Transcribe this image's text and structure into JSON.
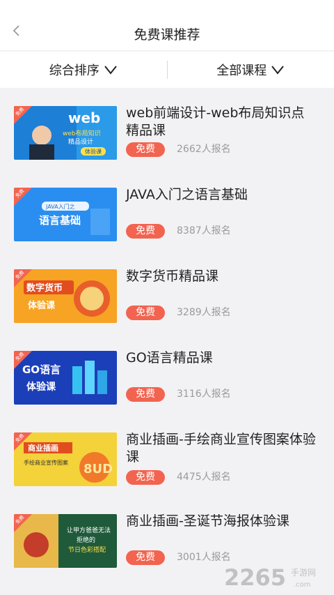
{
  "header": {
    "title": "免费课推荐",
    "back_icon": "chevron-left-icon"
  },
  "filters": [
    {
      "label": "综合排序",
      "icon": "chevron-down-icon"
    },
    {
      "label": "全部课程",
      "icon": "chevron-down-icon"
    }
  ],
  "courses": [
    {
      "title": "web前端设计-web布局知识点精品课",
      "badge": "免费",
      "enrolled": "2662人报名",
      "thumb": {
        "ribbon": "免费",
        "big": "web",
        "line1": "web布局知识",
        "line2": "精品设计",
        "tag": "体验课"
      }
    },
    {
      "title": "JAVA入门之语言基础",
      "badge": "免费",
      "enrolled": "8387人报名",
      "thumb": {
        "ribbon": "免费",
        "line1": "JAVA入门之",
        "line2": "语言基础"
      }
    },
    {
      "title": "数字货币精品课",
      "badge": "免费",
      "enrolled": "3289人报名",
      "thumb": {
        "ribbon": "免费",
        "line1": "数字货币",
        "line2": "体验课"
      }
    },
    {
      "title": "GO语言精品课",
      "badge": "免费",
      "enrolled": "3116人报名",
      "thumb": {
        "ribbon": "免费",
        "line1": "GO语言",
        "line2": "体验课"
      }
    },
    {
      "title": "商业插画-手绘商业宣传图案体验课",
      "badge": "免费",
      "enrolled": "4475人报名",
      "thumb": {
        "ribbon": "免费",
        "line1": "商业插画",
        "line2": "手绘商业宣传图案",
        "big": "8UD"
      }
    },
    {
      "title": "商业插画-圣诞节海报体验课",
      "badge": "免费",
      "enrolled": "3001人报名",
      "thumb": {
        "ribbon": "免费",
        "line1": "让甲方爸爸无法",
        "line2": "拒绝的",
        "line3": "节日色彩搭配"
      }
    }
  ],
  "watermark": {
    "number": "2265",
    "suffix": "手游网",
    "url": ".com"
  },
  "colors": {
    "accent": "#f26450",
    "background": "#f2f2f5"
  }
}
